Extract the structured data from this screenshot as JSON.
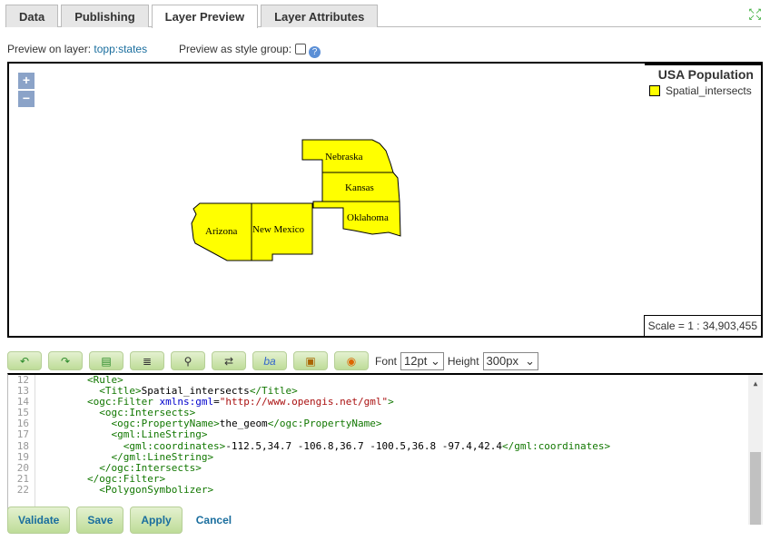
{
  "tabs": [
    {
      "label": "Data"
    },
    {
      "label": "Publishing"
    },
    {
      "label": "Layer Preview"
    },
    {
      "label": "Layer Attributes"
    }
  ],
  "preview": {
    "label": "Preview on layer:",
    "layer": "topp:states",
    "group_label": "Preview as style group:",
    "group_checked": false
  },
  "map": {
    "zoom_in": "+",
    "zoom_out": "−",
    "legend_title": "USA Population",
    "legend_item": "Spatial_intersects",
    "legend_color": "#ffff00",
    "scale": "Scale = 1 : 34,903,455",
    "states": [
      "Nebraska",
      "Kansas",
      "Oklahoma",
      "Arizona",
      "New Mexico"
    ]
  },
  "toolbar": {
    "icons": [
      "undo-icon",
      "redo-icon",
      "goto-line-icon",
      "reformat-icon",
      "find-icon",
      "find-replace-icon",
      "font-size-icon",
      "image-icon",
      "color-picker-icon"
    ],
    "font_label": "Font",
    "font_value": "12pt",
    "height_label": "Height",
    "height_value": "300px"
  },
  "editor": {
    "line_numbers": [
      "12",
      "13",
      "14",
      "15",
      "16",
      "17",
      "18",
      "19",
      "20",
      "21",
      "22"
    ],
    "lines": [
      [
        "        ",
        "<Rule>",
        "",
        ""
      ],
      [
        "          ",
        "<Title>",
        "Spatial_intersects",
        "</Title>"
      ],
      [
        "        ",
        "<ogc:Filter ",
        "",
        ""
      ],
      [
        "          ",
        "<ogc:Intersects>",
        "",
        ""
      ],
      [
        "            ",
        "<ogc:PropertyName>",
        "the_geom",
        "</ogc:PropertyName>"
      ],
      [
        "            ",
        "<gml:LineString>",
        "",
        ""
      ],
      [
        "              ",
        "<gml:coordinates>",
        "-112.5,34.7 -106.8,36.7 -100.5,36.8 -97.4,42.4",
        "</gml:coordinates>"
      ],
      [
        "            ",
        "</gml:LineString>",
        "",
        ""
      ],
      [
        "          ",
        "</ogc:Intersects>",
        "",
        ""
      ],
      [
        "        ",
        "</ogc:Filter>",
        "",
        ""
      ],
      [
        "          ",
        "<PolygonSymbolizer>",
        "",
        ""
      ]
    ],
    "filter_attr": "xmlns:gml",
    "filter_eq": "=",
    "filter_val": "\"http://www.opengis.net/gml\"",
    "filter_close": ">"
  },
  "buttons": {
    "validate": "Validate",
    "save": "Save",
    "apply": "Apply",
    "cancel": "Cancel"
  }
}
